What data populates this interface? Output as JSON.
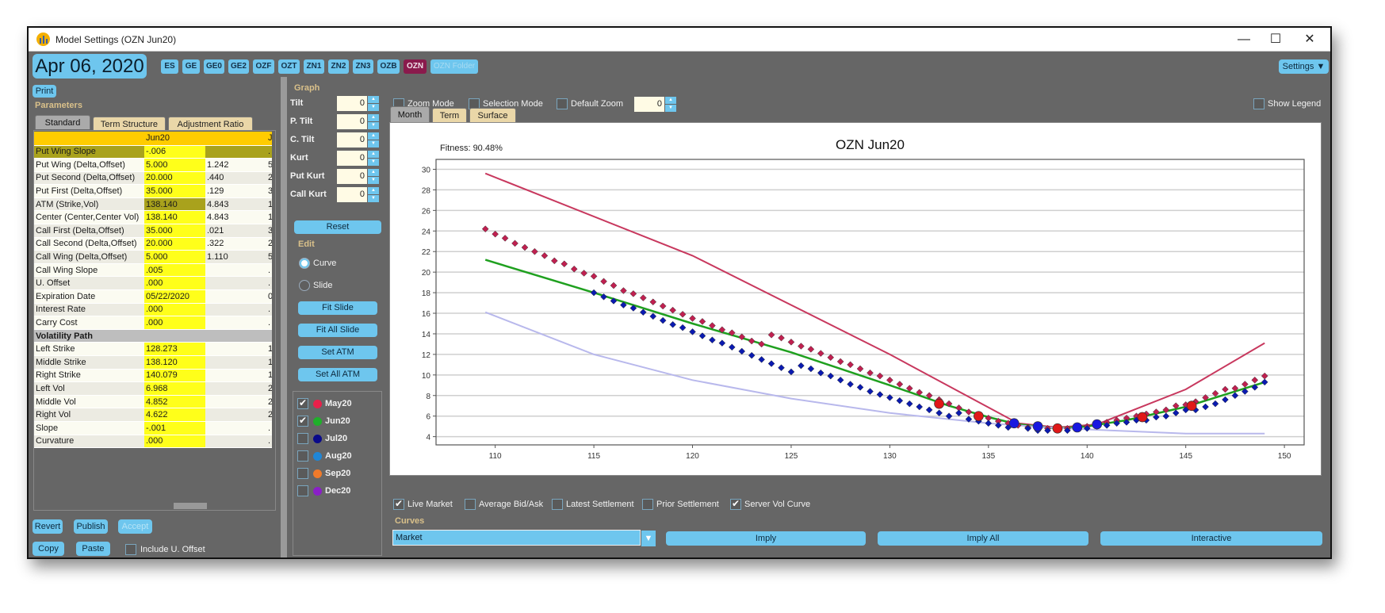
{
  "window": {
    "title": "Model Settings (OZN Jun20)",
    "controls": {
      "minimize": "—",
      "maximize": "☐",
      "close": "✕"
    }
  },
  "header": {
    "date": "Apr 06, 2020",
    "symbols": [
      {
        "label": "ES",
        "state": "normal"
      },
      {
        "label": "GE",
        "state": "normal"
      },
      {
        "label": "GE0",
        "state": "normal"
      },
      {
        "label": "GE2",
        "state": "normal"
      },
      {
        "label": "OZF",
        "state": "normal"
      },
      {
        "label": "OZT",
        "state": "normal"
      },
      {
        "label": "ZN1",
        "state": "normal"
      },
      {
        "label": "ZN2",
        "state": "normal"
      },
      {
        "label": "ZN3",
        "state": "normal"
      },
      {
        "label": "OZB",
        "state": "normal"
      },
      {
        "label": "OZN",
        "state": "active"
      },
      {
        "label": "OZN Folder",
        "state": "disabled"
      }
    ],
    "settings_label": "Settings ▼"
  },
  "left": {
    "print_label": "Print",
    "parameters_label": "Parameters",
    "tabs": [
      {
        "label": "Standard",
        "active": true
      },
      {
        "label": "Term Structure",
        "active": false
      },
      {
        "label": "Adjustment Ratio",
        "active": false
      }
    ],
    "table": {
      "header": [
        "",
        "Jun20",
        "",
        "J"
      ],
      "rows": [
        {
          "label": "Put Wing Slope",
          "v1": "-.006",
          "v2": "",
          "v3": ".",
          "type": "selected"
        },
        {
          "label": "Put Wing (Delta,Offset)",
          "v1": "5.000",
          "v2": "1.242",
          "v3": "5"
        },
        {
          "label": "Put Second (Delta,Offset)",
          "v1": "20.000",
          "v2": ".440",
          "v3": "2"
        },
        {
          "label": "Put First (Delta,Offset)",
          "v1": "35.000",
          "v2": ".129",
          "v3": "3"
        },
        {
          "label": "ATM (Strike,Vol)",
          "v1": "138.140",
          "v2": "4.843",
          "v3": "1",
          "type": "atm"
        },
        {
          "label": "Center (Center,Center Vol)",
          "v1": "138.140",
          "v2": "4.843",
          "v3": "1"
        },
        {
          "label": "Call First (Delta,Offset)",
          "v1": "35.000",
          "v2": ".021",
          "v3": "3"
        },
        {
          "label": "Call Second (Delta,Offset)",
          "v1": "20.000",
          "v2": ".322",
          "v3": "2"
        },
        {
          "label": "Call Wing (Delta,Offset)",
          "v1": "5.000",
          "v2": "1.110",
          "v3": "5"
        },
        {
          "label": "Call Wing Slope",
          "v1": ".005",
          "v2": "",
          "v3": "."
        },
        {
          "label": "U. Offset",
          "v1": ".000",
          "v2": "",
          "v3": "."
        },
        {
          "label": "Expiration Date",
          "v1": "05/22/2020",
          "v2": "",
          "v3": "0"
        },
        {
          "label": "Interest Rate",
          "v1": ".000",
          "v2": "",
          "v3": "."
        },
        {
          "label": "Carry Cost",
          "v1": ".000",
          "v2": "",
          "v3": "."
        },
        {
          "label": "Volatility Path",
          "v1": "",
          "v2": "",
          "v3": "",
          "type": "group"
        },
        {
          "label": "Left Strike",
          "v1": "128.273",
          "v2": "",
          "v3": "1"
        },
        {
          "label": "Middle Strike",
          "v1": "138.120",
          "v2": "",
          "v3": "1"
        },
        {
          "label": "Right Strike",
          "v1": "140.079",
          "v2": "",
          "v3": "1"
        },
        {
          "label": "Left Vol",
          "v1": "6.968",
          "v2": "",
          "v3": "2"
        },
        {
          "label": "Middle Vol",
          "v1": "4.852",
          "v2": "",
          "v3": "2"
        },
        {
          "label": "Right Vol",
          "v1": "4.622",
          "v2": "",
          "v3": "2"
        },
        {
          "label": "Slope",
          "v1": "-.001",
          "v2": "",
          "v3": "."
        },
        {
          "label": "Curvature",
          "v1": ".000",
          "v2": "",
          "v3": "."
        }
      ]
    },
    "buttons": {
      "revert": "Revert",
      "publish": "Publish",
      "accept": "Accept",
      "copy": "Copy",
      "paste": "Paste"
    },
    "include_offset": {
      "label": "Include U. Offset",
      "checked": false
    }
  },
  "graph_panel": {
    "label": "Graph",
    "spinners": [
      {
        "label": "Tilt",
        "value": "0"
      },
      {
        "label": "P. Tilt",
        "value": "0"
      },
      {
        "label": "C. Tilt",
        "value": "0"
      },
      {
        "label": "Kurt",
        "value": "0"
      },
      {
        "label": "Put Kurt",
        "value": "0"
      },
      {
        "label": "Call Kurt",
        "value": "0"
      }
    ],
    "reset_label": "Reset",
    "edit_label": "Edit",
    "edit_modes": [
      {
        "label": "Curve",
        "selected": true
      },
      {
        "label": "Slide",
        "selected": false
      }
    ],
    "actions": [
      "Fit Slide",
      "Fit All Slide",
      "Set ATM",
      "Set All ATM"
    ],
    "months": [
      {
        "label": "May20",
        "checked": true,
        "color": "#e8204a"
      },
      {
        "label": "Jun20",
        "checked": true,
        "color": "#1fb02a"
      },
      {
        "label": "Jul20",
        "checked": false,
        "color": "#0a0a8a"
      },
      {
        "label": "Aug20",
        "checked": false,
        "color": "#1f86d6"
      },
      {
        "label": "Sep20",
        "checked": false,
        "color": "#f07a2a"
      },
      {
        "label": "Dec20",
        "checked": false,
        "color": "#8a1fc8"
      }
    ]
  },
  "toolbar": {
    "zoom_mode": {
      "label": "Zoom Mode",
      "checked": false
    },
    "selection_mode": {
      "label": "Selection Mode",
      "checked": false
    },
    "default_zoom": {
      "label": "Default Zoom",
      "checked": false
    },
    "zoom_value": "0",
    "show_legend": {
      "label": "Show Legend",
      "checked": false
    }
  },
  "chart_tabs": [
    {
      "label": "Month",
      "active": true
    },
    {
      "label": "Term",
      "active": false
    },
    {
      "label": "Surface",
      "active": false
    }
  ],
  "chart_data": {
    "type": "line",
    "title": "OZN Jun20",
    "annotation": "Fitness: 90.48%",
    "xlabel": "",
    "ylabel": "",
    "xlim": [
      107,
      151
    ],
    "ylim": [
      3.2,
      30.5
    ],
    "xticks": [
      110,
      115,
      120,
      125,
      130,
      135,
      140,
      145,
      150
    ],
    "yticks": [
      4,
      6,
      8,
      10,
      12,
      14,
      16,
      18,
      20,
      22,
      24,
      26,
      28,
      30
    ],
    "grid": "horizontal",
    "series": [
      {
        "name": "Upper bound curve",
        "kind": "line",
        "color": "#c8385e",
        "points": [
          [
            109.5,
            29.6
          ],
          [
            120,
            21.6
          ],
          [
            130,
            12.0
          ],
          [
            136.5,
            5.3
          ],
          [
            138.5,
            4.9
          ],
          [
            140.5,
            5.2
          ],
          [
            145,
            8.6
          ],
          [
            149,
            13.1
          ]
        ]
      },
      {
        "name": "Model curve (Jun20)",
        "kind": "line",
        "color": "#1fa01f",
        "points": [
          [
            109.5,
            21.2
          ],
          [
            115,
            18.0
          ],
          [
            120,
            15.0
          ],
          [
            125,
            12.2
          ],
          [
            130,
            9.0
          ],
          [
            133,
            7.0
          ],
          [
            135,
            5.9
          ],
          [
            136.5,
            5.2
          ],
          [
            138.5,
            4.8
          ],
          [
            140,
            5.0
          ],
          [
            142,
            5.6
          ],
          [
            145,
            6.9
          ],
          [
            149,
            9.3
          ]
        ]
      },
      {
        "name": "Lower curve",
        "kind": "line",
        "color": "#b8b8ec",
        "points": [
          [
            109.5,
            16.1
          ],
          [
            115,
            12.0
          ],
          [
            120,
            9.5
          ],
          [
            125,
            7.7
          ],
          [
            130,
            6.3
          ],
          [
            135,
            5.3
          ],
          [
            138,
            4.9
          ],
          [
            140,
            4.7
          ],
          [
            145,
            4.3
          ],
          [
            149,
            4.3
          ]
        ]
      },
      {
        "name": "Ask markers",
        "kind": "diamond",
        "color": "#c02050",
        "points": [
          [
            109.5,
            24.2
          ],
          [
            110,
            23.7
          ],
          [
            110.5,
            23.3
          ],
          [
            111,
            22.8
          ],
          [
            111.5,
            22.4
          ],
          [
            112,
            22.0
          ],
          [
            112.5,
            21.6
          ],
          [
            113,
            21.1
          ],
          [
            113.5,
            20.8
          ],
          [
            114,
            20.3
          ],
          [
            114.5,
            19.9
          ],
          [
            115,
            19.6
          ],
          [
            115.5,
            19.1
          ],
          [
            116,
            18.7
          ],
          [
            116.5,
            18.2
          ],
          [
            117,
            17.9
          ],
          [
            117.5,
            17.5
          ],
          [
            118,
            17.1
          ],
          [
            118.5,
            16.7
          ],
          [
            119,
            16.3
          ],
          [
            119.5,
            15.9
          ],
          [
            120,
            15.5
          ],
          [
            120.5,
            15.2
          ],
          [
            121,
            14.8
          ],
          [
            121.5,
            14.4
          ],
          [
            122,
            14.1
          ],
          [
            122.5,
            13.7
          ],
          [
            123,
            13.3
          ],
          [
            123.5,
            13.0
          ],
          [
            124,
            13.9
          ],
          [
            124.5,
            13.6
          ],
          [
            125,
            13.2
          ],
          [
            125.5,
            12.8
          ],
          [
            126,
            12.5
          ],
          [
            126.5,
            12.1
          ],
          [
            127,
            11.7
          ],
          [
            127.5,
            11.3
          ],
          [
            128,
            11.0
          ],
          [
            128.5,
            10.6
          ],
          [
            129,
            10.2
          ],
          [
            129.5,
            9.9
          ],
          [
            130,
            9.5
          ],
          [
            130.5,
            9.1
          ],
          [
            131,
            8.7
          ],
          [
            131.5,
            8.3
          ],
          [
            132,
            8.0
          ],
          [
            132.5,
            7.6
          ],
          [
            133,
            7.2
          ],
          [
            133.5,
            6.8
          ],
          [
            134,
            6.4
          ],
          [
            134.5,
            6.1
          ],
          [
            135,
            5.8
          ],
          [
            135.5,
            5.5
          ],
          [
            136,
            5.3
          ],
          [
            136.5,
            5.1
          ],
          [
            137,
            4.9
          ],
          [
            137.5,
            4.9
          ],
          [
            138,
            4.8
          ],
          [
            138.5,
            4.8
          ],
          [
            139,
            4.8
          ],
          [
            139.5,
            4.9
          ],
          [
            140,
            5.0
          ],
          [
            140.5,
            5.2
          ],
          [
            141,
            5.4
          ],
          [
            141.5,
            5.6
          ],
          [
            142,
            5.8
          ],
          [
            142.5,
            6.0
          ],
          [
            143,
            6.2
          ],
          [
            143.5,
            6.4
          ],
          [
            144,
            6.6
          ],
          [
            144.5,
            7.0
          ],
          [
            145,
            7.1
          ],
          [
            145.5,
            7.4
          ],
          [
            146,
            7.8
          ],
          [
            146.5,
            8.2
          ],
          [
            147,
            8.6
          ],
          [
            147.5,
            8.7
          ],
          [
            148,
            9.1
          ],
          [
            148.5,
            9.5
          ],
          [
            149,
            9.9
          ]
        ]
      },
      {
        "name": "Bid markers",
        "kind": "diamond",
        "color": "#0a1ab0",
        "points": [
          [
            115,
            18.0
          ],
          [
            115.5,
            17.6
          ],
          [
            116,
            17.2
          ],
          [
            116.5,
            16.8
          ],
          [
            117,
            16.5
          ],
          [
            117.5,
            16.1
          ],
          [
            118,
            15.7
          ],
          [
            118.5,
            15.3
          ],
          [
            119,
            14.9
          ],
          [
            119.5,
            14.6
          ],
          [
            120,
            14.2
          ],
          [
            120.5,
            13.8
          ],
          [
            121,
            13.4
          ],
          [
            121.5,
            13.1
          ],
          [
            122,
            12.7
          ],
          [
            122.5,
            12.3
          ],
          [
            123,
            11.9
          ],
          [
            123.5,
            11.5
          ],
          [
            124,
            11.1
          ],
          [
            124.5,
            10.7
          ],
          [
            125,
            10.3
          ],
          [
            125.5,
            10.9
          ],
          [
            126,
            10.6
          ],
          [
            126.5,
            10.2
          ],
          [
            127,
            9.9
          ],
          [
            127.5,
            9.5
          ],
          [
            128,
            9.1
          ],
          [
            128.5,
            8.8
          ],
          [
            129,
            8.4
          ],
          [
            129.5,
            8.1
          ],
          [
            130,
            7.8
          ],
          [
            130.5,
            7.5
          ],
          [
            131,
            7.2
          ],
          [
            131.5,
            6.9
          ],
          [
            132,
            6.6
          ],
          [
            132.5,
            6.3
          ],
          [
            133,
            6.0
          ],
          [
            133.5,
            6.3
          ],
          [
            134,
            5.7
          ],
          [
            134.5,
            5.5
          ],
          [
            135,
            5.3
          ],
          [
            135.5,
            5.1
          ],
          [
            136,
            4.9
          ],
          [
            137,
            4.8
          ],
          [
            137.5,
            4.6
          ],
          [
            138,
            4.6
          ],
          [
            139,
            4.6
          ],
          [
            140,
            4.8
          ],
          [
            140.5,
            5.0
          ],
          [
            141,
            5.1
          ],
          [
            141.5,
            5.3
          ],
          [
            142,
            5.4
          ],
          [
            142.5,
            5.6
          ],
          [
            143,
            5.6
          ],
          [
            143.5,
            5.9
          ],
          [
            144,
            6.0
          ],
          [
            144.5,
            6.3
          ],
          [
            145,
            6.6
          ],
          [
            145.5,
            6.6
          ],
          [
            146,
            6.9
          ],
          [
            146.5,
            7.2
          ],
          [
            147,
            7.6
          ],
          [
            147.5,
            8.0
          ],
          [
            148,
            8.4
          ],
          [
            148.5,
            8.8
          ],
          [
            149,
            9.3
          ]
        ]
      },
      {
        "name": "Settlement points (red)",
        "kind": "circle",
        "color": "#e01818",
        "points": [
          [
            132.5,
            7.2
          ],
          [
            134.5,
            6.0
          ],
          [
            138.5,
            4.8
          ],
          [
            142.8,
            5.9
          ],
          [
            145.3,
            7.0
          ]
        ]
      },
      {
        "name": "Settlement points (blue)",
        "kind": "circle",
        "color": "#1818e0",
        "points": [
          [
            136.3,
            5.3
          ],
          [
            137.5,
            5.0
          ],
          [
            139.5,
            4.9
          ],
          [
            140.5,
            5.2
          ]
        ]
      }
    ]
  },
  "bottom": {
    "checkboxes": [
      {
        "label": "Live Market",
        "checked": true
      },
      {
        "label": "Average Bid/Ask",
        "checked": false
      },
      {
        "label": "Latest Settlement",
        "checked": false
      },
      {
        "label": "Prior Settlement",
        "checked": false
      },
      {
        "label": "Server Vol Curve",
        "checked": true
      }
    ],
    "curves_label": "Curves",
    "curve_select": "Market",
    "imply_label": "Imply",
    "imply_all_label": "Imply All",
    "interactive_label": "Interactive"
  }
}
